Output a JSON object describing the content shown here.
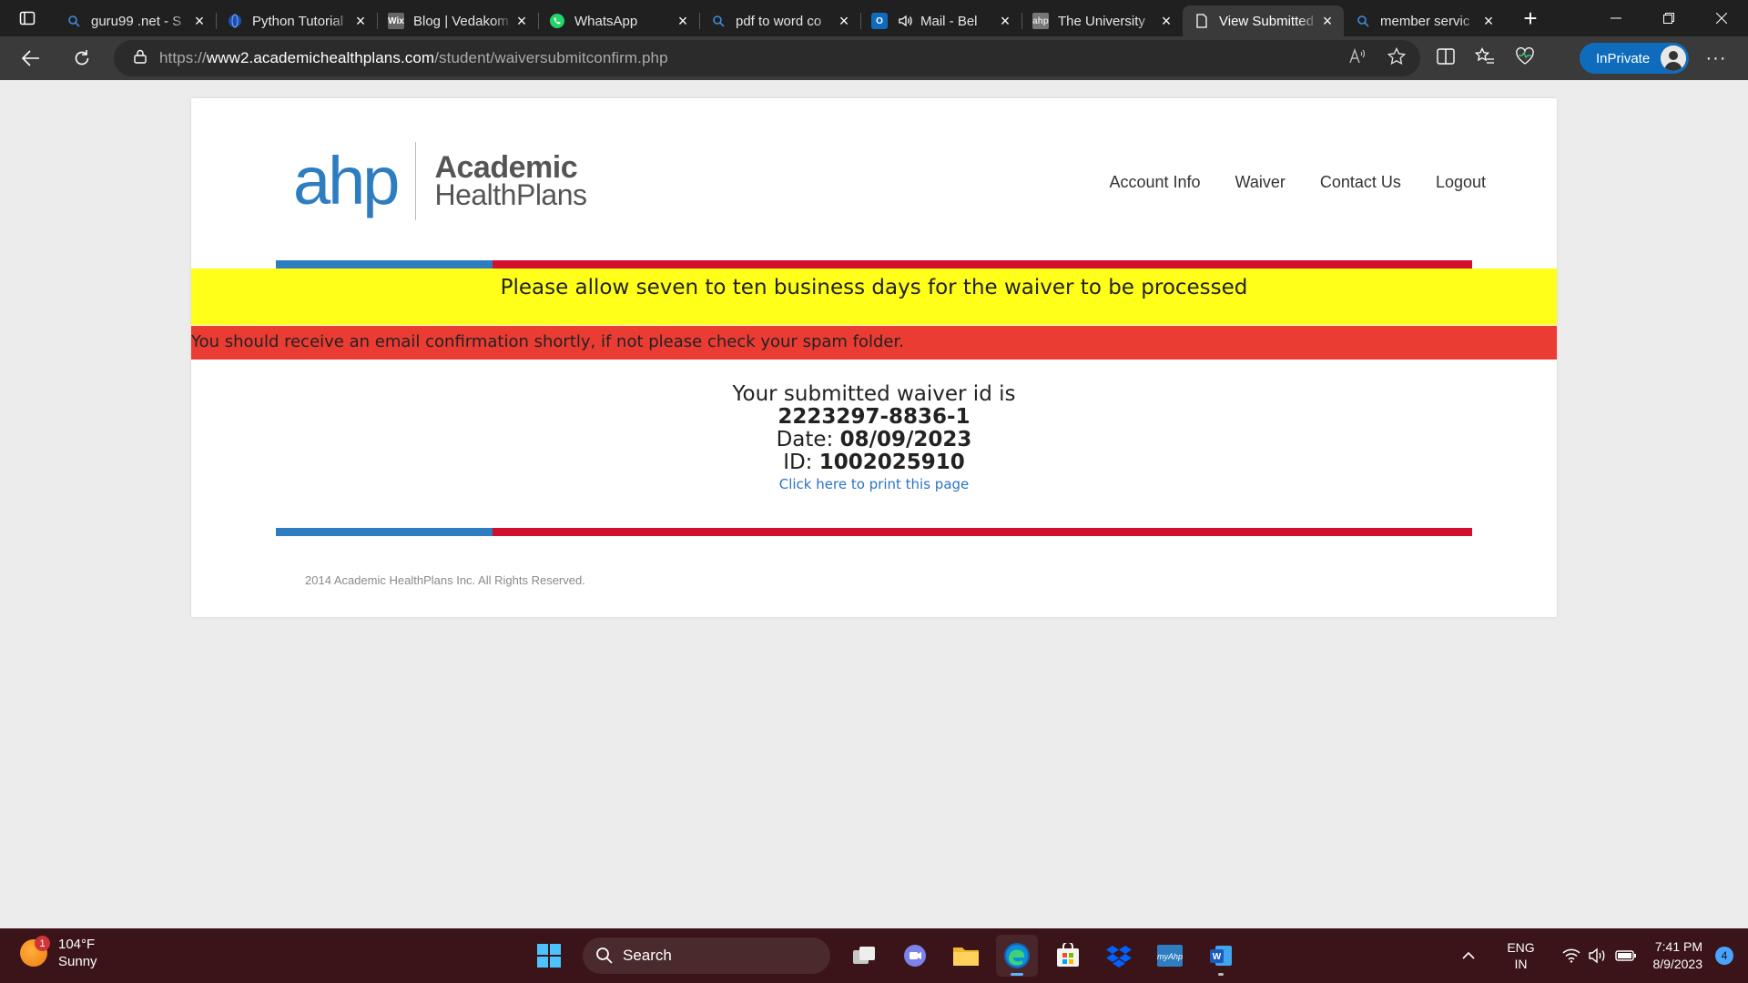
{
  "browser": {
    "tabs": [
      {
        "title": "guru99 .net - S",
        "icon": "search-icon"
      },
      {
        "title": "Python Tutorial",
        "icon": "globe-icon"
      },
      {
        "title": "Blog | Vedakom",
        "icon": "wix-icon"
      },
      {
        "title": "WhatsApp",
        "icon": "whatsapp-icon"
      },
      {
        "title": "pdf to word co",
        "icon": "search-icon"
      },
      {
        "title": "Mail - Bel",
        "icon": "outlook-icon"
      },
      {
        "title": "The University",
        "icon": "ahp-icon"
      },
      {
        "title": "View Submitted",
        "icon": "page-icon",
        "active": true
      },
      {
        "title": "member servic",
        "icon": "search-icon"
      }
    ],
    "url_prefix": "https://",
    "url_domain": "www2.academichealthplans.com",
    "url_path": "/student/waiversubmitconfirm.php",
    "inprivate_label": "InPrivate"
  },
  "site": {
    "logo_ahp": "ahp",
    "logo_line1": "Academic",
    "logo_line2": "HealthPlans",
    "nav": [
      "Account Info",
      "Waiver",
      "Contact Us",
      "Logout"
    ]
  },
  "notices": {
    "yellow": "Please allow seven to ten business days for the waiver to be processed",
    "red": "You should receive an email confirmation shortly, if not please check your spam folder."
  },
  "confirmation": {
    "intro": "Your submitted waiver id is",
    "waiver_id": "2223297-8836-1",
    "date_label": "Date:",
    "date_value": "08/09/2023",
    "id_label": "ID:",
    "id_value": "1002025910",
    "print_link": "Click here to print this page"
  },
  "footer": {
    "copyright": "2014 Academic HealthPlans Inc. All Rights Reserved."
  },
  "taskbar": {
    "weather_temp": "104°F",
    "weather_desc": "Sunny",
    "weather_badge": "1",
    "search_label": "Search",
    "lang_line1": "ENG",
    "lang_line2": "IN",
    "time": "7:41 PM",
    "date": "8/9/2023",
    "notification_count": "4"
  },
  "colors": {
    "brand_blue": "#2f7dc1",
    "brand_red": "#d0102e",
    "notice_yellow": "#ffff1a",
    "notice_red": "#ea3c33",
    "link_blue": "#2a74c4"
  }
}
